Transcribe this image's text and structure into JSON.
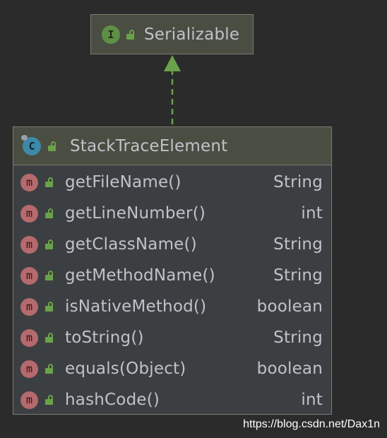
{
  "interface": {
    "badge": "I",
    "name": "Serializable",
    "icon": "interface-icon"
  },
  "class": {
    "badge": "C",
    "name": "StackTraceElement",
    "icon": "class-icon"
  },
  "methods": [
    {
      "badge": "m",
      "name": "getFileName()",
      "type": "String"
    },
    {
      "badge": "m",
      "name": "getLineNumber()",
      "type": "int"
    },
    {
      "badge": "m",
      "name": "getClassName()",
      "type": "String"
    },
    {
      "badge": "m",
      "name": "getMethodName()",
      "type": "String"
    },
    {
      "badge": "m",
      "name": "isNativeMethod()",
      "type": "boolean"
    },
    {
      "badge": "m",
      "name": "toString()",
      "type": "String"
    },
    {
      "badge": "m",
      "name": "equals(Object)",
      "type": "boolean"
    },
    {
      "badge": "m",
      "name": "hashCode()",
      "type": "int"
    }
  ],
  "relation": "implements",
  "watermark": "https://blog.csdn.net/Dax1n",
  "colors": {
    "background": "#2b2b2b",
    "node_header": "#4a4d42",
    "node_body": "#3c3f41",
    "interface_badge": "#5e8f45",
    "class_badge": "#3e88a8",
    "method_badge": "#b56a6e",
    "public_lock": "#6aa24a",
    "arrow": "#6aa24a"
  }
}
